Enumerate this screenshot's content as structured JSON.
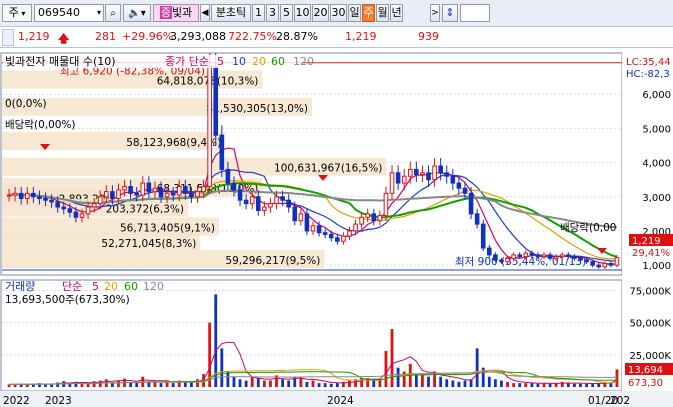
{
  "toolbar": {
    "market_label": "주",
    "code_value": "069540",
    "name_badge": "빛과",
    "period_buttons": [
      "분초틱",
      "1",
      "3",
      "5",
      "10",
      "20",
      "30",
      "일",
      "주",
      "월",
      "년"
    ],
    "active_period": "주"
  },
  "quote": {
    "price": "1,219",
    "change": "281",
    "change_pct": "+29.96%",
    "volume": "3,293,088",
    "volume_pct": "722.75%",
    "turnover": "28.87%",
    "price2": "1,219",
    "prev": "939"
  },
  "price_panel": {
    "title": "빛과전자 매물대 수(10)",
    "ma_label": "종가 단순",
    "ma_periods": [
      "5",
      "10",
      "20",
      "60",
      "120"
    ],
    "ma_colors": [
      "#d0006e",
      "#1c3fbf",
      "#e0a000",
      "#10a000",
      "#888888"
    ],
    "lc_label": "LC:35,44",
    "hc_label": "HC:-82,3",
    "high_note": "최고 6,920 (-82,38%, 09/04)",
    "low_note": "최저 900 (35,44%, 01/13)",
    "dividend_notes": [
      "배당락(0,00%)",
      "배당락(0,00"
    ],
    "zero_note": "0(0,0%)",
    "current_price_tag": "1,219",
    "current_pct_tag": "29,41%",
    "y_ticks": [
      "6,000",
      "5,000",
      "4,000",
      "3,000",
      "2,000",
      "1,000"
    ],
    "y_values": [
      6000,
      5000,
      4000,
      3000,
      2000,
      1000
    ],
    "volume_profile": [
      {
        "label": "64,818,078(10,3%)"
      },
      {
        "label": "81,530,305(13,0%)"
      },
      {
        "label": "58,123,968(9,4%)"
      },
      {
        "label": "100,631,967(16,5%)"
      },
      {
        "label": "68,311,543(11,0%)"
      },
      {
        "label": "2,893,20)"
      },
      {
        "label": "203,372(6,3%)"
      },
      {
        "label": "56,713,405(9,1%)"
      },
      {
        "label": "52,271,045(8,3%)"
      },
      {
        "label": "59,296,217(9,5%)"
      }
    ]
  },
  "volume_panel": {
    "title": "거래량",
    "ma_label": "단순",
    "ma_periods": [
      "5",
      "20",
      "60",
      "120"
    ],
    "ma_colors": [
      "#d0006e",
      "#e0a000",
      "#10a000",
      "#888888"
    ],
    "info": "13,693,500주(673,30%)",
    "y_ticks": [
      "75,000K",
      "50,000K",
      "25,000K"
    ],
    "y_values": [
      75000,
      50000,
      25000
    ],
    "current_tag": "13,694",
    "current_pct_tag": "673,30"
  },
  "x_axis": {
    "labels": [
      "2022",
      "2023",
      "2024",
      "01/20",
      "202"
    ]
  },
  "chart_data": {
    "type": "candlestick",
    "y_unit": "KRW",
    "price_ylim": [
      800,
      7000
    ],
    "volume_ylim": [
      0,
      80000
    ],
    "volume_unit": "K shares",
    "weeks": 110,
    "close": [
      3050,
      3100,
      2950,
      3100,
      3000,
      2950,
      2900,
      2850,
      2700,
      2650,
      2550,
      2400,
      2500,
      2700,
      2800,
      3000,
      3150,
      2950,
      3200,
      3300,
      3100,
      3050,
      3400,
      3150,
      3250,
      3000,
      3100,
      3050,
      3300,
      3100,
      3000,
      3150,
      3300,
      6800,
      4800,
      3800,
      3400,
      3200,
      2900,
      2800,
      3000,
      2600,
      2700,
      2800,
      3000,
      2900,
      2700,
      2300,
      2500,
      2000,
      2150,
      1950,
      1900,
      1800,
      1700,
      1850,
      2000,
      2200,
      2400,
      2500,
      2300,
      2450,
      3100,
      3700,
      3400,
      3600,
      3800,
      3650,
      3700,
      3500,
      3900,
      3700,
      3600,
      3400,
      3250,
      3100,
      2500,
      2200,
      1500,
      1300,
      1150,
      1100,
      1200,
      1300,
      1250,
      1350,
      1300,
      1250,
      1300,
      1200,
      1250,
      1300,
      1250,
      1200,
      1150,
      1100,
      1000,
      950,
      1050,
      1000,
      1219
    ],
    "volume": [
      2000,
      2000,
      2500,
      2000,
      1800,
      3000,
      2500,
      2200,
      3500,
      4500,
      3000,
      4000,
      2500,
      3000,
      4500,
      5000,
      6000,
      3500,
      5000,
      6500,
      4000,
      3500,
      8000,
      4500,
      5000,
      3000,
      4000,
      3000,
      5000,
      4000,
      3500,
      6000,
      10000,
      50000,
      72000,
      30000,
      12000,
      8000,
      6000,
      5000,
      8000,
      7000,
      5000,
      5000,
      9000,
      6000,
      5000,
      8000,
      7000,
      4000,
      5000,
      3000,
      3000,
      2500,
      3000,
      4000,
      5000,
      6000,
      7000,
      7000,
      5000,
      6000,
      28000,
      45000,
      15000,
      12000,
      18000,
      10000,
      9000,
      8000,
      12000,
      8000,
      6000,
      5000,
      4000,
      5000,
      6000,
      30000,
      15000,
      8000,
      6000,
      5000,
      4000,
      3000,
      3000,
      3000,
      3000,
      2500,
      3000,
      2500,
      3000,
      4000,
      3000,
      2500,
      2500,
      2500,
      3000,
      3000,
      4000,
      3000,
      13694
    ]
  }
}
